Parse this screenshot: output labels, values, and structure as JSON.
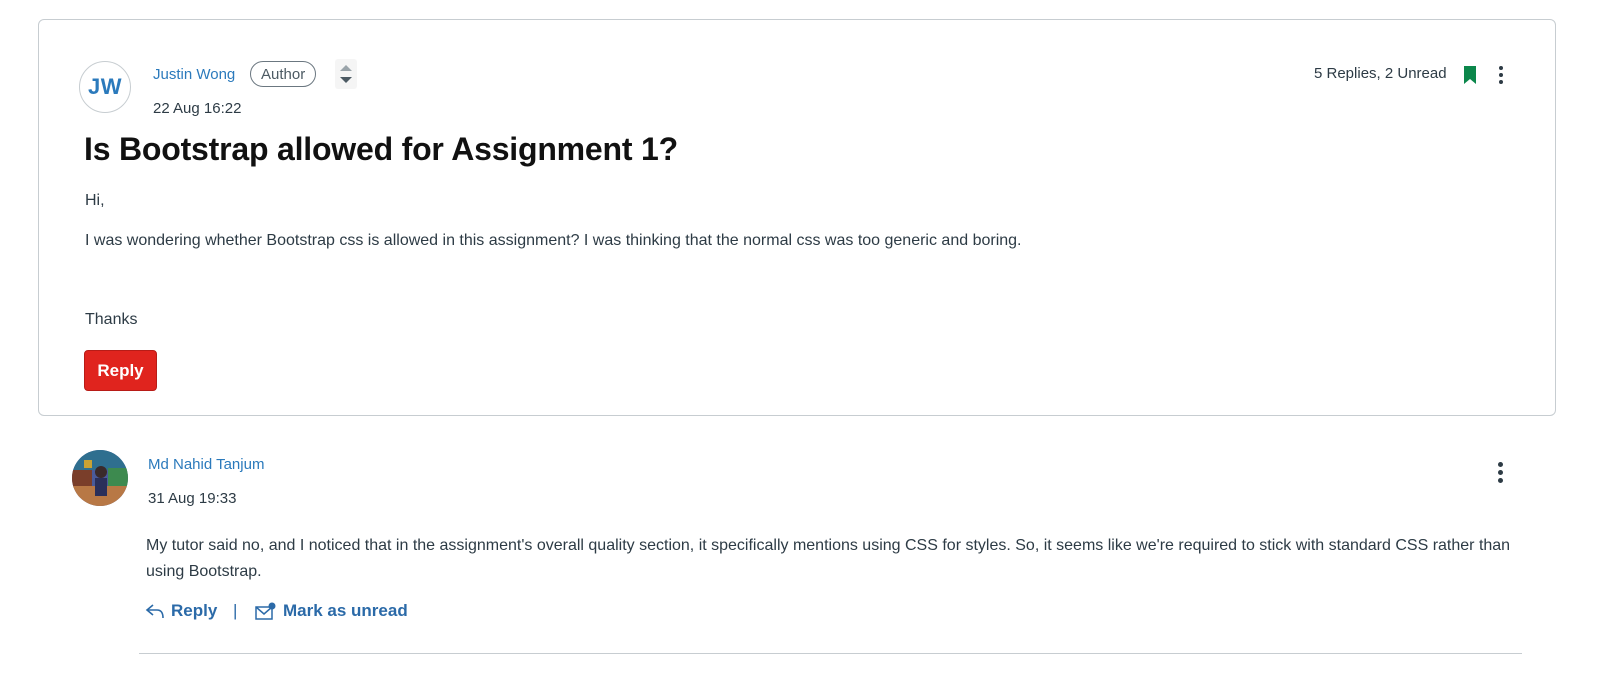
{
  "topic": {
    "author_initials": "JW",
    "author_name": "Justin Wong",
    "author_role": "Author",
    "date": "22 Aug 16:22",
    "reply_summary": "5 Replies, 2 Unread",
    "title": "Is Bootstrap allowed for Assignment 1?",
    "body": [
      "Hi,",
      "I was wondering whether Bootstrap css is allowed in this assignment? I was thinking that the normal css was too generic and boring.",
      "Thanks"
    ],
    "reply_button": "Reply"
  },
  "reply": {
    "author_name": "Md Nahid Tanjum",
    "date": "31 Aug 19:33",
    "body": "My tutor said no, and I noticed that in the assignment's overall quality section, it specifically mentions using CSS for styles. So, it seems like we're required to stick with standard CSS rather than using Bootstrap.",
    "reply_label": "Reply",
    "separator": "|",
    "mark_unread_label": "Mark as unread"
  },
  "colors": {
    "link": "#2b7abc",
    "primary_button": "#e0241e",
    "bookmark": "#0b874b"
  }
}
